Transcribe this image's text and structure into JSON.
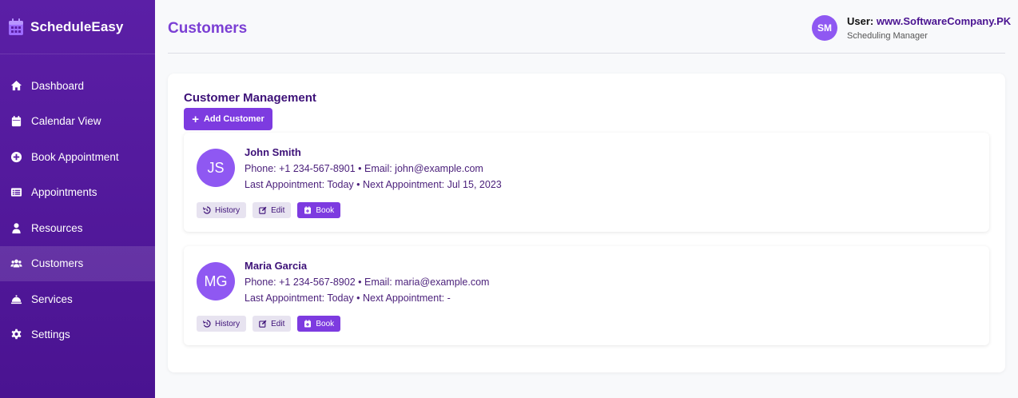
{
  "app": {
    "name": "ScheduleEasy",
    "icon": "calendar-icon"
  },
  "sidebar": {
    "items": [
      {
        "label": "Dashboard",
        "icon": "home-icon",
        "active": false
      },
      {
        "label": "Calendar View",
        "icon": "calendar-icon",
        "active": false
      },
      {
        "label": "Book Appointment",
        "icon": "plus-circle-icon",
        "active": false
      },
      {
        "label": "Appointments",
        "icon": "list-icon",
        "active": false
      },
      {
        "label": "Resources",
        "icon": "user-tie-icon",
        "active": false
      },
      {
        "label": "Customers",
        "icon": "users-icon",
        "active": true
      },
      {
        "label": "Services",
        "icon": "bell-concierge-icon",
        "active": false
      },
      {
        "label": "Settings",
        "icon": "gear-icon",
        "active": false
      }
    ]
  },
  "header": {
    "title": "Customers",
    "user": {
      "initials": "SM",
      "label": "User:",
      "name": "www.SoftwareCompany.PK",
      "role": "Scheduling Manager"
    }
  },
  "main": {
    "section_title": "Customer Management",
    "add_button_label": "Add Customer",
    "customers": [
      {
        "initials": "JS",
        "name": "John Smith",
        "contact": "Phone: +1 234-567-8901 • Email: john@example.com",
        "appointments": "Last Appointment: Today • Next Appointment: Jul 15, 2023",
        "actions": {
          "history": "History",
          "edit": "Edit",
          "book": "Book"
        }
      },
      {
        "initials": "MG",
        "name": "Maria Garcia",
        "contact": "Phone: +1 234-567-8902 • Email: maria@example.com",
        "appointments": "Last Appointment: Today • Next Appointment: -",
        "actions": {
          "history": "History",
          "edit": "Edit",
          "book": "Book"
        }
      }
    ]
  },
  "colors": {
    "sidebar": "#5b1fa6",
    "accent": "#7d3be0",
    "avatar": "#8f58f2",
    "title": "#7b3fd4"
  }
}
